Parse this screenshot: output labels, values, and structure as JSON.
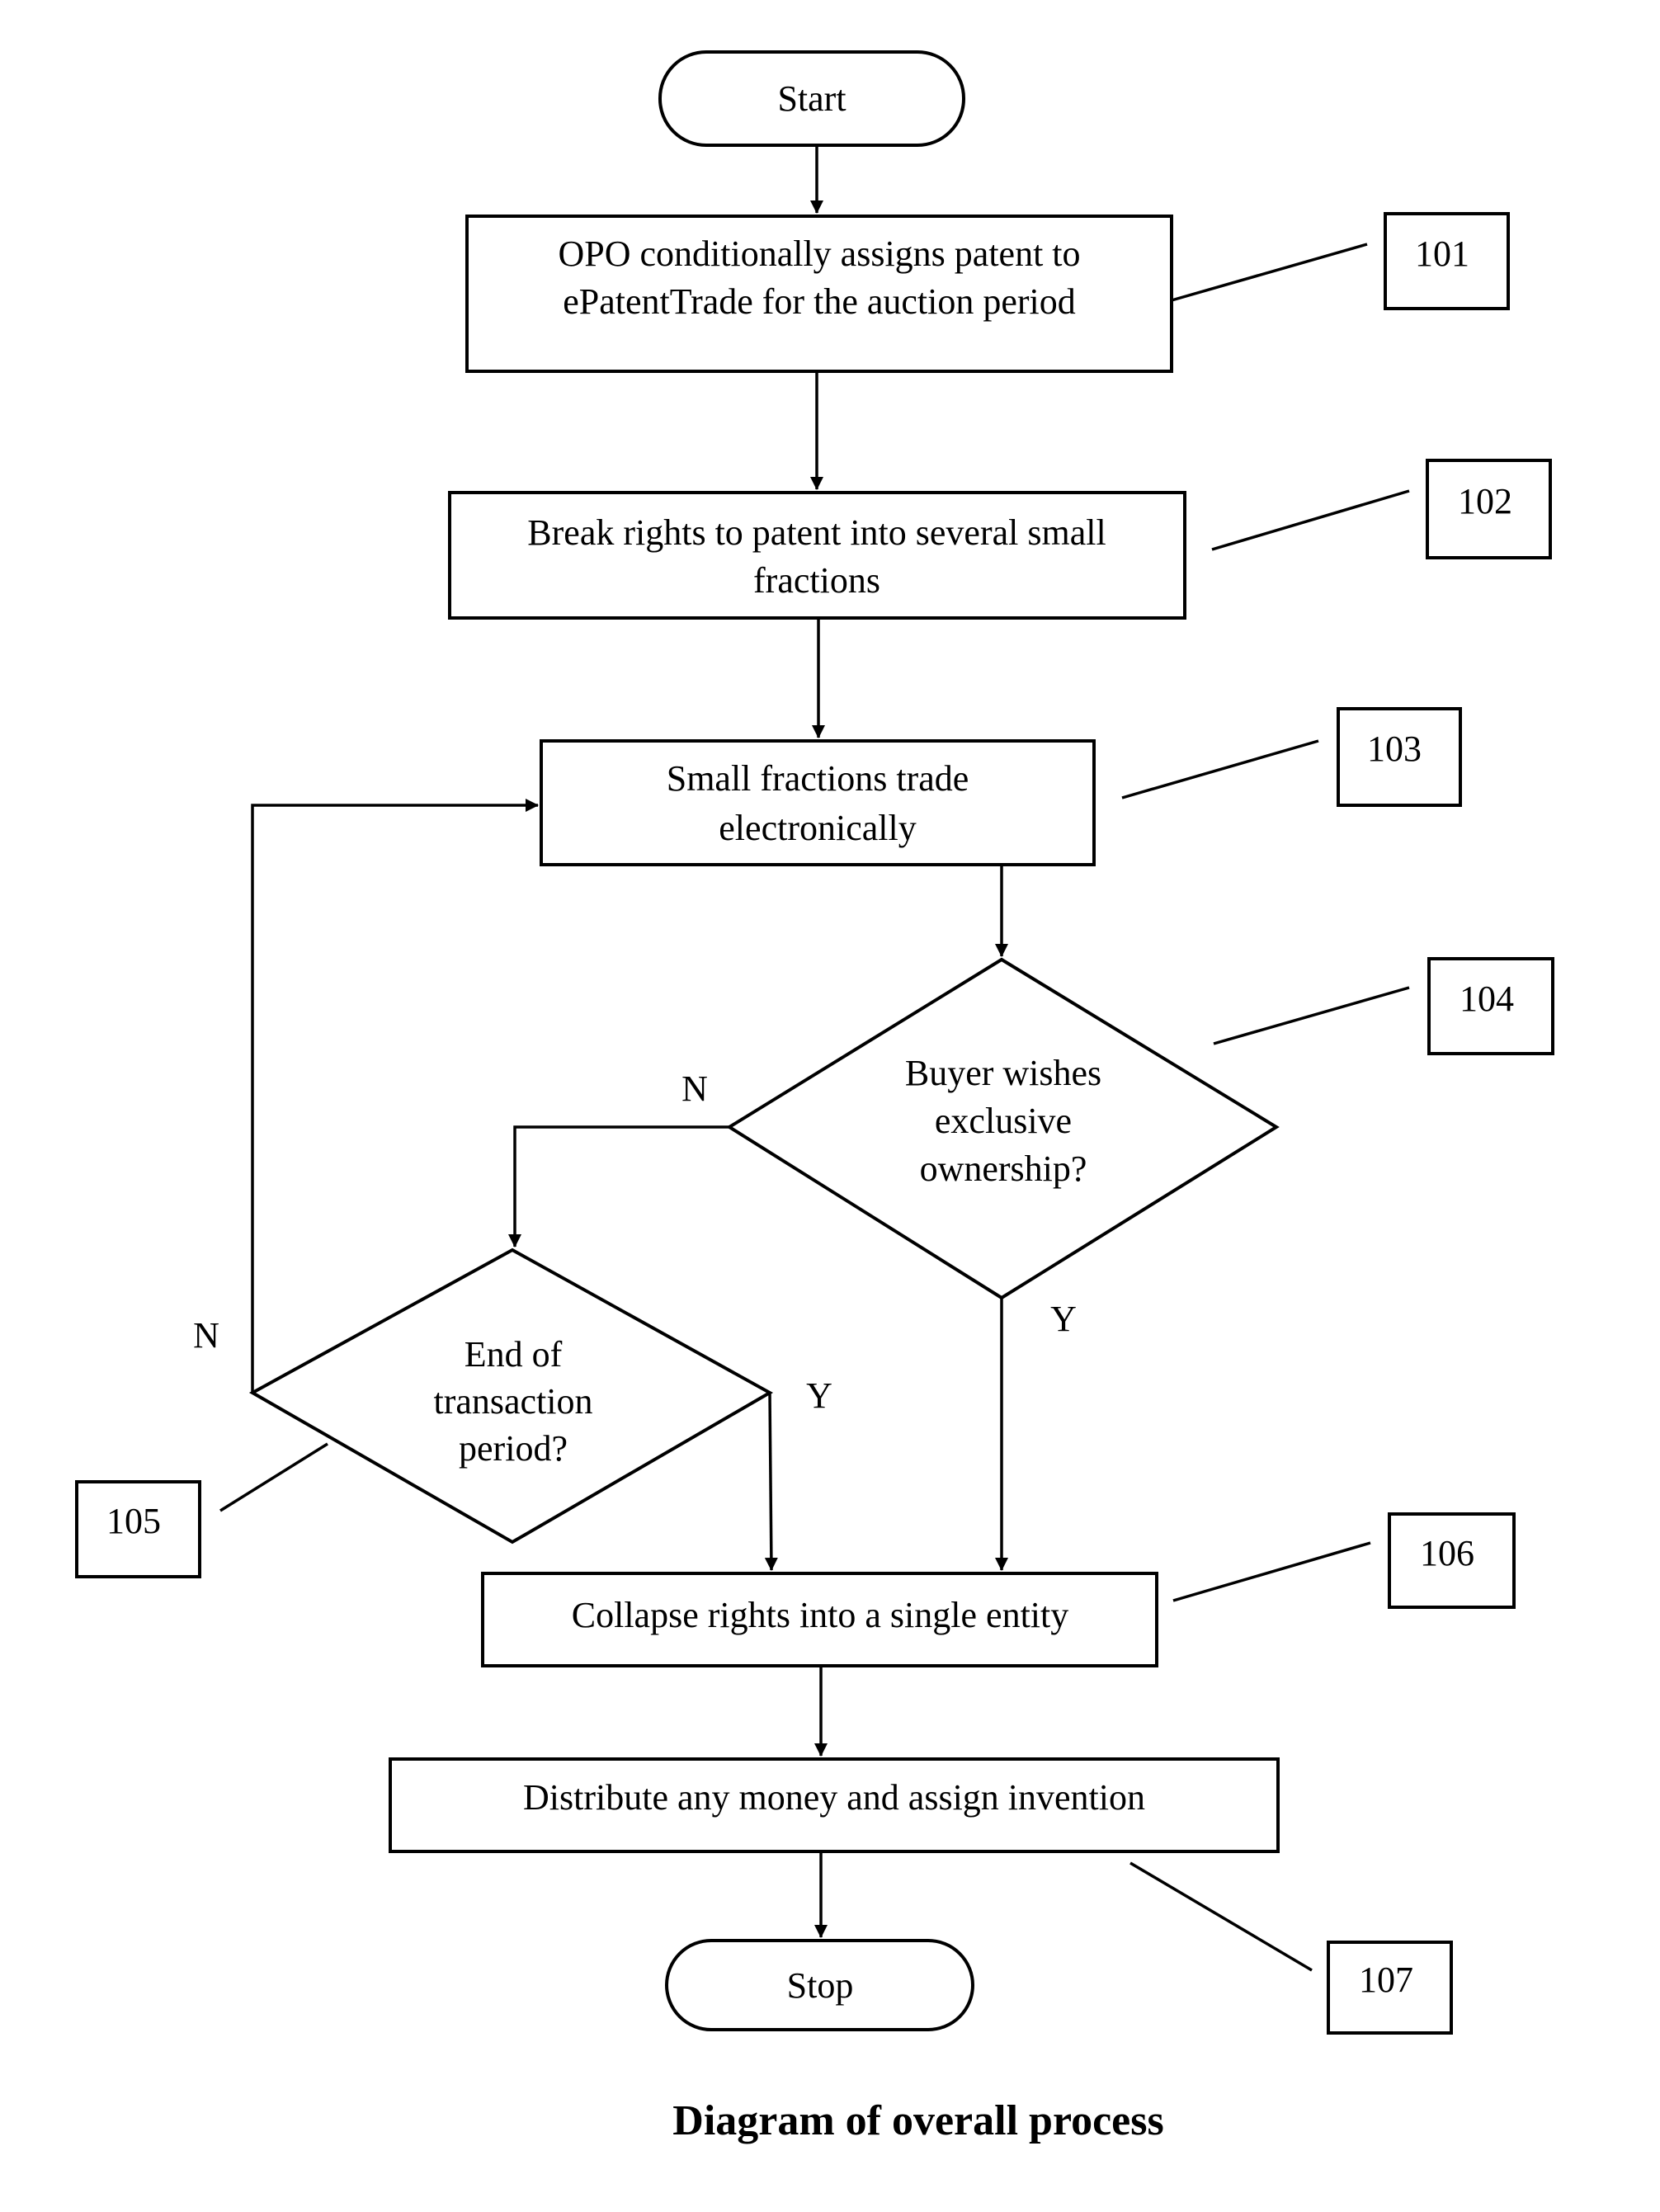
{
  "diagram": {
    "title": "Diagram of overall process",
    "nodes": {
      "start": {
        "type": "terminator",
        "label": "Start"
      },
      "step101": {
        "type": "process",
        "ref": "101",
        "lines": [
          "OPO conditionally assigns patent to",
          "ePatentTrade for the auction period"
        ]
      },
      "step102": {
        "type": "process",
        "ref": "102",
        "lines": [
          "Break rights to patent into several small",
          "fractions"
        ]
      },
      "step103": {
        "type": "process",
        "ref": "103",
        "lines": [
          "Small fractions trade",
          "electronically"
        ]
      },
      "step104": {
        "type": "decision",
        "ref": "104",
        "lines": [
          "Buyer wishes",
          "exclusive",
          "ownership?"
        ]
      },
      "step105": {
        "type": "decision",
        "ref": "105",
        "lines": [
          "End of",
          "transaction",
          "period?"
        ]
      },
      "step106": {
        "type": "process",
        "ref": "106",
        "lines": [
          "Collapse rights into a single entity"
        ]
      },
      "step107": {
        "type": "process",
        "ref": "107",
        "lines": [
          "Distribute any money and assign invention"
        ]
      },
      "stop": {
        "type": "terminator",
        "label": "Stop"
      }
    },
    "edges": [
      {
        "from": "start",
        "to": "step101",
        "label": ""
      },
      {
        "from": "step101",
        "to": "step102",
        "label": ""
      },
      {
        "from": "step102",
        "to": "step103",
        "label": ""
      },
      {
        "from": "step103",
        "to": "step104",
        "label": ""
      },
      {
        "from": "step104",
        "to": "step105",
        "label": "N"
      },
      {
        "from": "step104",
        "to": "step106",
        "label": "Y"
      },
      {
        "from": "step105",
        "to": "step103",
        "label": "N"
      },
      {
        "from": "step105",
        "to": "step106",
        "label": "Y"
      },
      {
        "from": "step106",
        "to": "step107",
        "label": ""
      },
      {
        "from": "step107",
        "to": "stop",
        "label": ""
      }
    ],
    "branch_labels": {
      "d104_no": "N",
      "d104_yes": "Y",
      "d105_no": "N",
      "d105_yes": "Y"
    }
  }
}
